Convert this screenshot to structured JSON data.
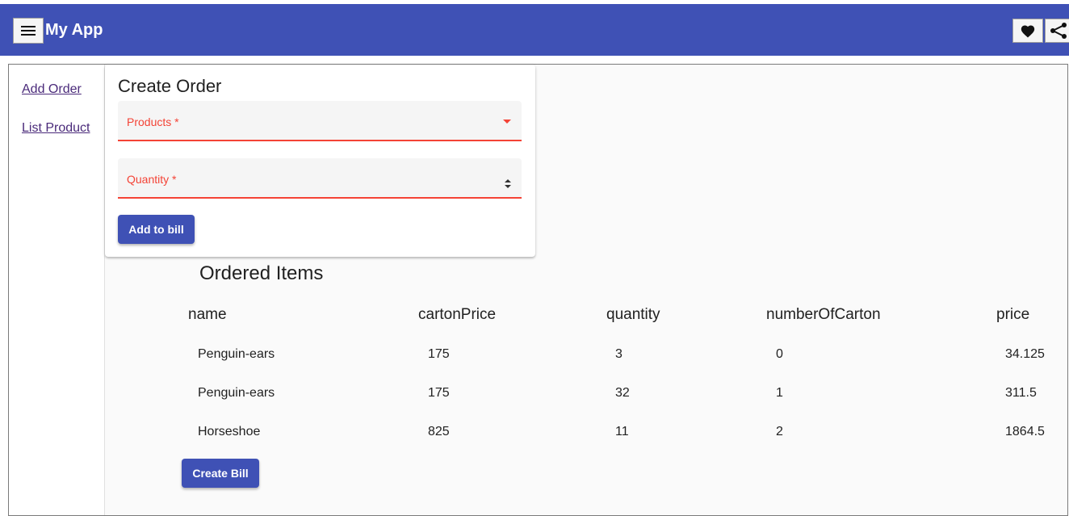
{
  "app": {
    "title": "My App"
  },
  "toolbar": {
    "menu_icon": "menu-icon",
    "favorite_icon": "heart-icon",
    "share_icon": "share-icon"
  },
  "sidebar": {
    "items": [
      {
        "label": "Add Order"
      },
      {
        "label": "List Product"
      }
    ]
  },
  "form": {
    "title": "Create Order",
    "products_label": "Products *",
    "quantity_label": "Quantity *",
    "add_button": "Add to bill"
  },
  "ordered": {
    "title": "Ordered Items",
    "columns": [
      "name",
      "cartonPrice",
      "quantity",
      "numberOfCarton",
      "price"
    ],
    "rows": [
      [
        "Penguin-ears",
        "175",
        "3",
        "0",
        "34.125"
      ],
      [
        "Penguin-ears",
        "175",
        "32",
        "1",
        "311.5"
      ],
      [
        "Horseshoe",
        "825",
        "11",
        "2",
        "1864.5"
      ]
    ],
    "create_button": "Create Bill"
  },
  "colors": {
    "primary": "#3f51b5",
    "warn": "#f44336",
    "link": "#4a2a7a"
  }
}
